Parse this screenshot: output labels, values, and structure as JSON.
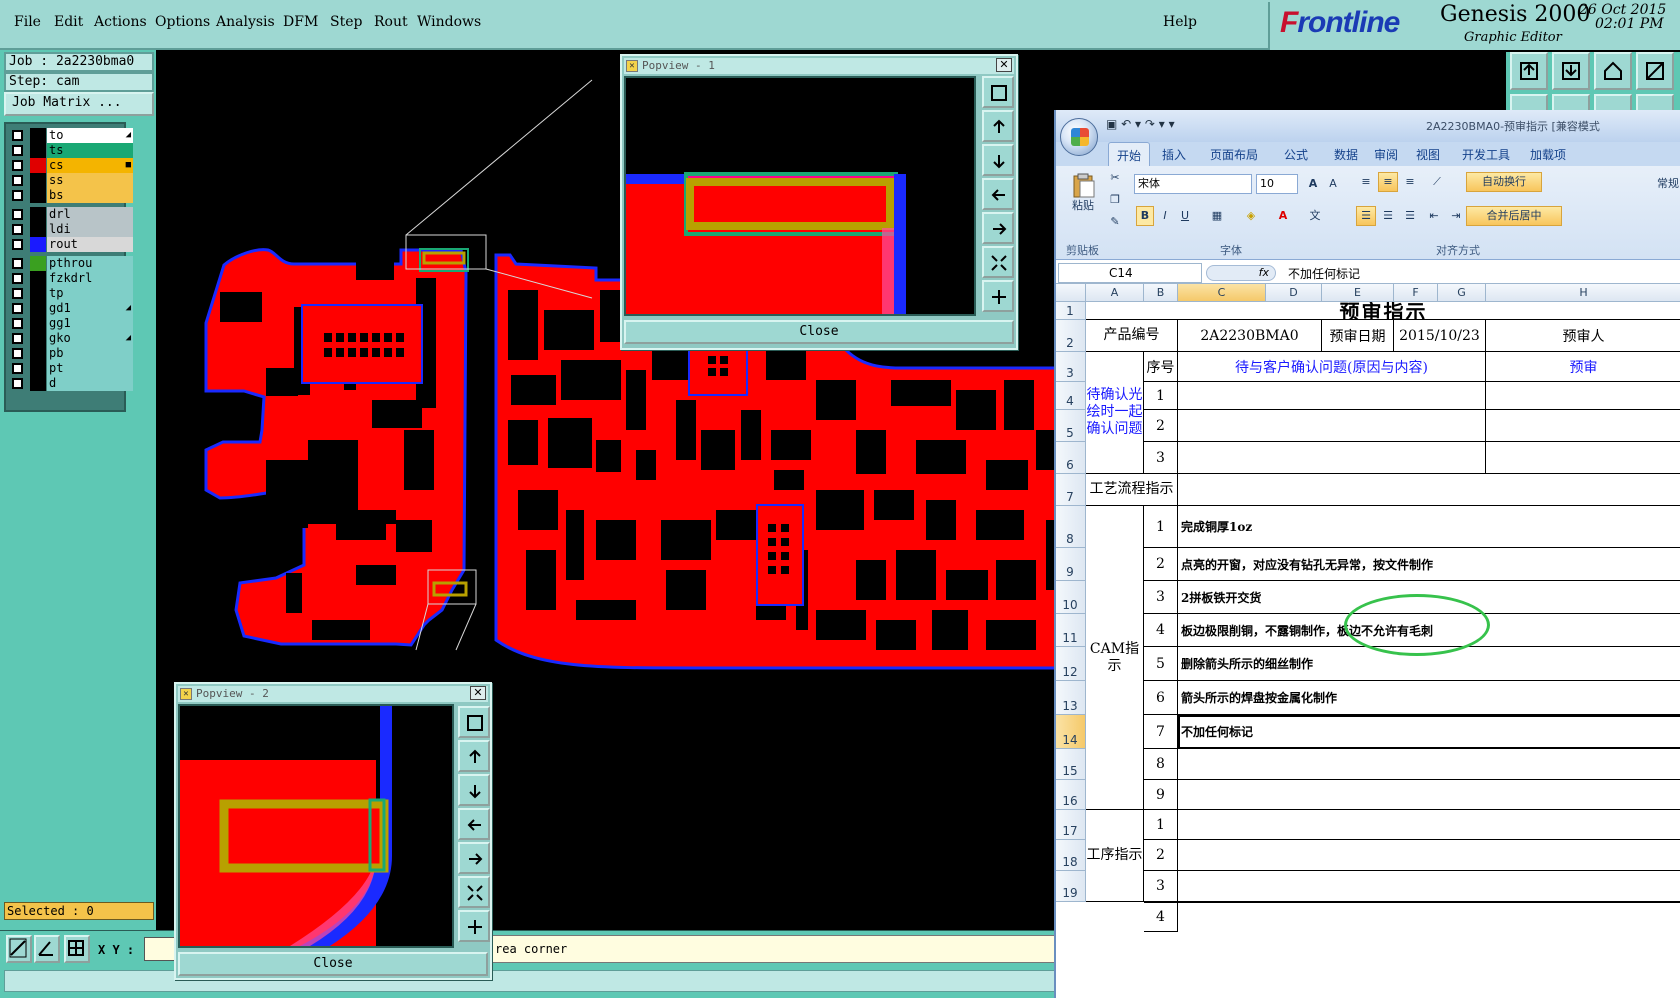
{
  "menubar": {
    "items": [
      "File",
      "Edit",
      "Actions",
      "Options",
      "Analysis",
      "DFM",
      "Step",
      "Rout",
      "Windows"
    ],
    "help": "Help"
  },
  "brand": {
    "logo_f": "F",
    "logo_rest": "rontline",
    "product": "Genesis 2000",
    "subtitle": "Graphic Editor",
    "date": "26 Oct 2015",
    "time": "02:01 PM"
  },
  "job": {
    "job_label": "Job : 2a2230bma0",
    "step_label": "Step: cam",
    "matrix_button": "Job Matrix ..."
  },
  "layers": [
    {
      "name": "to",
      "color": "#ffffff",
      "mark": "◢"
    },
    {
      "name": "ts",
      "color": "#1aa874",
      "mark": ""
    },
    {
      "name": "cs",
      "color": "#f4b400",
      "mark": "■"
    },
    {
      "name": "ss",
      "color": "#f4c34a",
      "mark": ""
    },
    {
      "name": "bs",
      "color": "#f4c34a",
      "mark": ""
    },
    {
      "name": "drl",
      "color": "#b8c4c8",
      "mark": ""
    },
    {
      "name": "ldi",
      "color": "#b8c4c8",
      "mark": ""
    },
    {
      "name": "rout",
      "color": "#d8d8d8",
      "mark": ""
    },
    {
      "name": "pthrou",
      "color": "#7fcfc8",
      "mark": ""
    },
    {
      "name": "fzkdrl",
      "color": "#7fcfc8",
      "mark": ""
    },
    {
      "name": "tp",
      "color": "#7fcfc8",
      "mark": ""
    },
    {
      "name": "gd1",
      "color": "#7fcfc8",
      "mark": "◢"
    },
    {
      "name": "gg1",
      "color": "#7fcfc8",
      "mark": ""
    },
    {
      "name": "gko",
      "color": "#7fcfc8",
      "mark": "◢"
    },
    {
      "name": "pb",
      "color": "#7fcfc8",
      "mark": ""
    },
    {
      "name": "pt",
      "color": "#7fcfc8",
      "mark": ""
    },
    {
      "name": "d",
      "color": "#7fcfc8",
      "mark": ""
    }
  ],
  "layer_swatches": [
    "#000000",
    "#000000",
    "#e00000",
    "#000000",
    "#000000",
    "#000000",
    "#000000",
    "#1a1aff",
    "#3aa020",
    "#000000",
    "#000000",
    "#000000",
    "#000000",
    "#000000",
    "#000000",
    "#000000",
    "#000000"
  ],
  "status": {
    "selected": "Selected : 0",
    "xy_label": "X Y :",
    "message": "rea corner"
  },
  "popview1": {
    "title": "Popview - 1",
    "close": "Close"
  },
  "popview2": {
    "title": "Popview - 2",
    "close": "Close"
  },
  "colors": {
    "copper": "#ff0000",
    "outline": "#1a2aff",
    "highlight": "#b8a000",
    "panel": "#5ec8b4",
    "menubar": "#9ed8d2"
  },
  "excel": {
    "doc_title": "2A2230BMA0-预审指示 [兼容模式",
    "qat": "▣ ↶ ▾ ↷ ▾ ▾",
    "tabs": [
      "开始",
      "插入",
      "页面布局",
      "公式",
      "数据",
      "审阅",
      "视图",
      "开发工具",
      "加载项"
    ],
    "ribbon": {
      "paste": "粘贴",
      "clipboard": "剪贴板",
      "font_name": "宋体",
      "font_size": "10",
      "font_group": "字体",
      "wrap_text": "自动换行",
      "merge_center": "合并后居中",
      "align_group": "对齐方式",
      "number_format": "常规"
    },
    "name_box": "C14",
    "fx": "fx",
    "formula": "不加任何标记",
    "columns": [
      "A",
      "B",
      "C",
      "D",
      "E",
      "F",
      "G",
      "H"
    ],
    "rows": [
      "1",
      "2",
      "3",
      "4",
      "5",
      "6",
      "7",
      "8",
      "9",
      "10",
      "11",
      "12",
      "13",
      "14",
      "15",
      "16",
      "17",
      "18",
      "19"
    ],
    "title": "预审指示",
    "product_label": "产品编号",
    "product_no": "2A2230BMA0",
    "review_date_label": "预审日期",
    "review_date": "2015/10/23",
    "reviewer_label": "预审人",
    "seq_header": "序号",
    "pending_header": "待与客户确认问题(原因与内容)",
    "pending_header2": "预审",
    "pending_group": "待确认光绘时一起确认问题",
    "process_label": "工艺流程指示",
    "cam_label": "CAM指示",
    "op_label": "工序指示",
    "cam_items": [
      {
        "no": "1",
        "text": "完成铜厚1oz"
      },
      {
        "no": "2",
        "text": "点亮的开窗，对应没有钻孔无异常，按文件制作"
      },
      {
        "no": "3",
        "text": "2拼板铁开交货"
      },
      {
        "no": "4",
        "text": "板边极限削铜，不露铜制作，板边不允许有毛刺"
      },
      {
        "no": "5",
        "text": "删除箭头所示的细丝制作"
      },
      {
        "no": "6",
        "text": "箭头所示的焊盘按金属化制作"
      },
      {
        "no": "7",
        "text": "不加任何标记"
      },
      {
        "no": "8",
        "text": ""
      },
      {
        "no": "9",
        "text": ""
      }
    ],
    "pending_nos": [
      "1",
      "2",
      "3"
    ],
    "op_nos": [
      "1",
      "2",
      "3",
      "4"
    ]
  }
}
